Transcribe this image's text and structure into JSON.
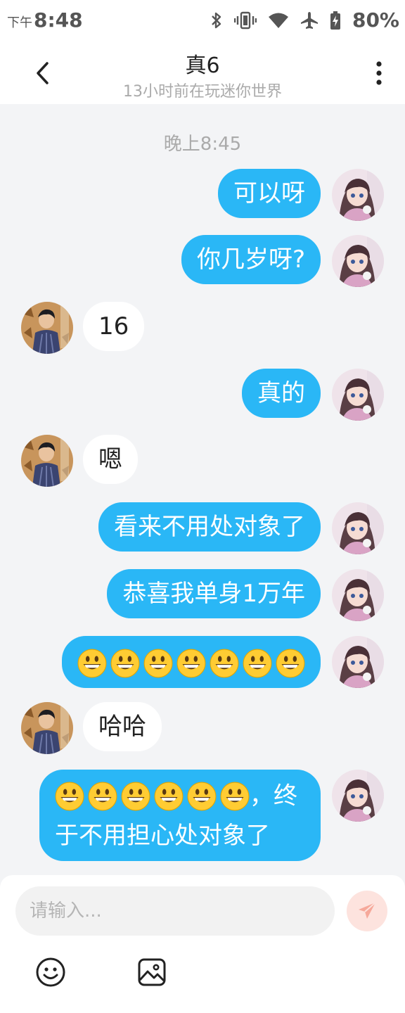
{
  "status_bar": {
    "period": "下午",
    "time": "8:48",
    "battery": "80%"
  },
  "header": {
    "title": "真6",
    "subtitle": "13小时前在玩迷你世界"
  },
  "timestamp": "晚上8:45",
  "messages": [
    {
      "sender": "me",
      "text": "可以呀"
    },
    {
      "sender": "me",
      "text": "你几岁呀?"
    },
    {
      "sender": "other",
      "text": "16"
    },
    {
      "sender": "me",
      "text": "真的"
    },
    {
      "sender": "other",
      "text": "嗯"
    },
    {
      "sender": "me",
      "text": "看来不用处对象了"
    },
    {
      "sender": "me",
      "text": "恭喜我单身1万年"
    },
    {
      "sender": "me",
      "emoji_count": 7,
      "emoji": "grinning-face"
    },
    {
      "sender": "other",
      "text": "哈哈"
    },
    {
      "sender": "me",
      "emoji_count": 6,
      "emoji": "grinning-face",
      "text_after_emoji": "，终",
      "text_line2": "于不用担心处对象了"
    }
  ],
  "input": {
    "placeholder": "请输入..."
  },
  "colors": {
    "my_bubble": "#2ab7f6",
    "other_bubble": "#ffffff",
    "send_button": "#fde3de",
    "send_icon": "#f6a89a"
  }
}
